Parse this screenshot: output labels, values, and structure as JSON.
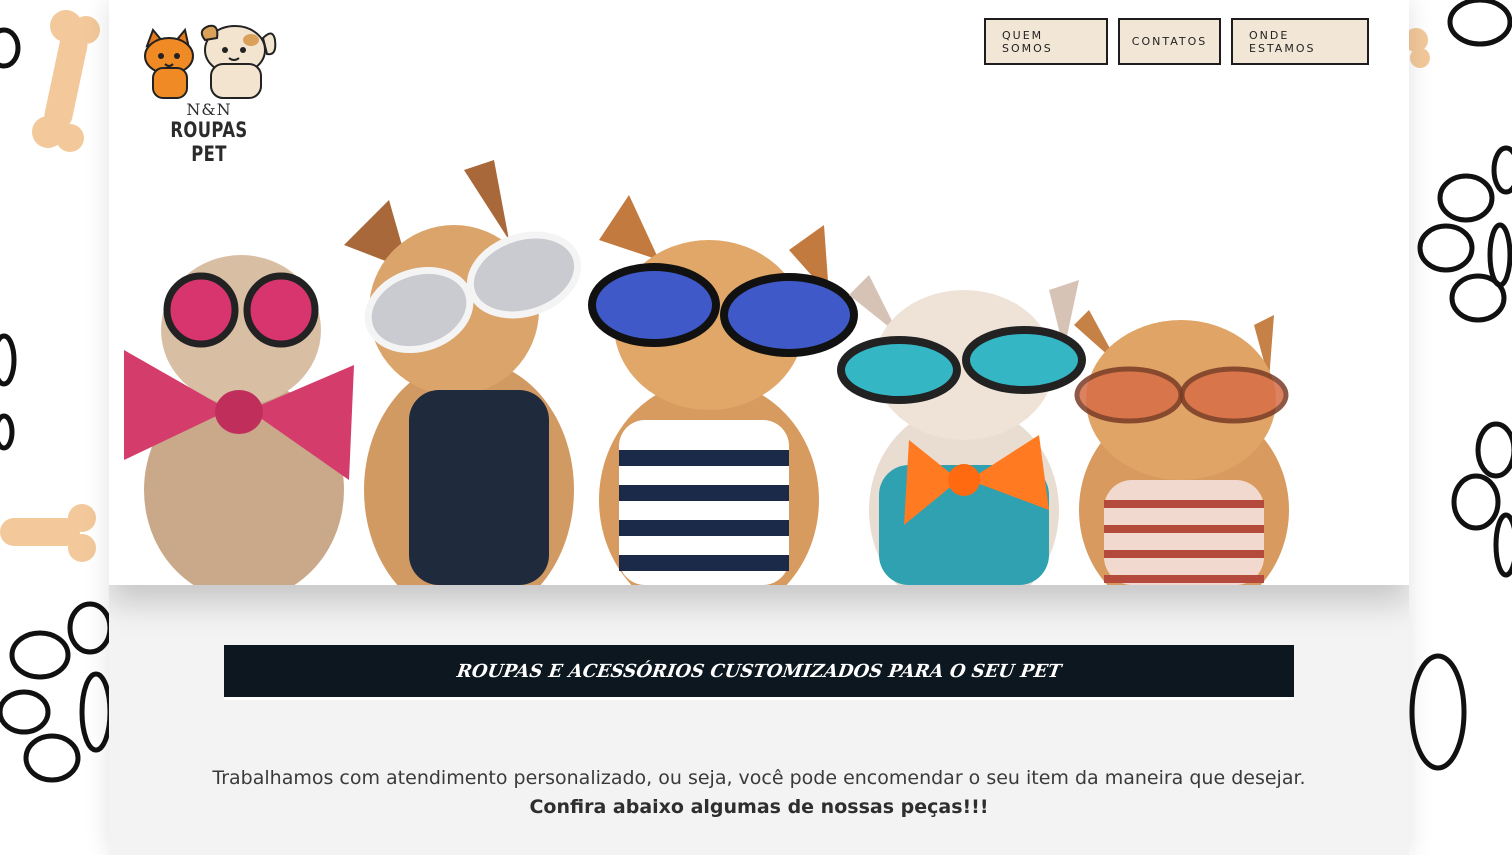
{
  "logo": {
    "top_text": "N&N",
    "bottom_text": "ROUPAS PET"
  },
  "nav": [
    {
      "label": "QUEM SOMOS"
    },
    {
      "label": "CONTATOS"
    },
    {
      "label": "ONDE ESTAMOS"
    }
  ],
  "banner": {
    "title": "ROUPAS E ACESSÓRIOS CUSTOMIZADOS PARA O SEU PET"
  },
  "intro": {
    "line1": "Trabalhamos com atendimento personalizado, ou seja, você pode encomendar o seu item da maneira que desejar.",
    "line2": "Confira abaixo algumas de nossas peças!!!"
  },
  "colors": {
    "nav_bg": "#f2e6d6",
    "banner_bg": "#0d171f",
    "card_bg": "#f3f3f3",
    "bone": "#f5cfa3"
  }
}
